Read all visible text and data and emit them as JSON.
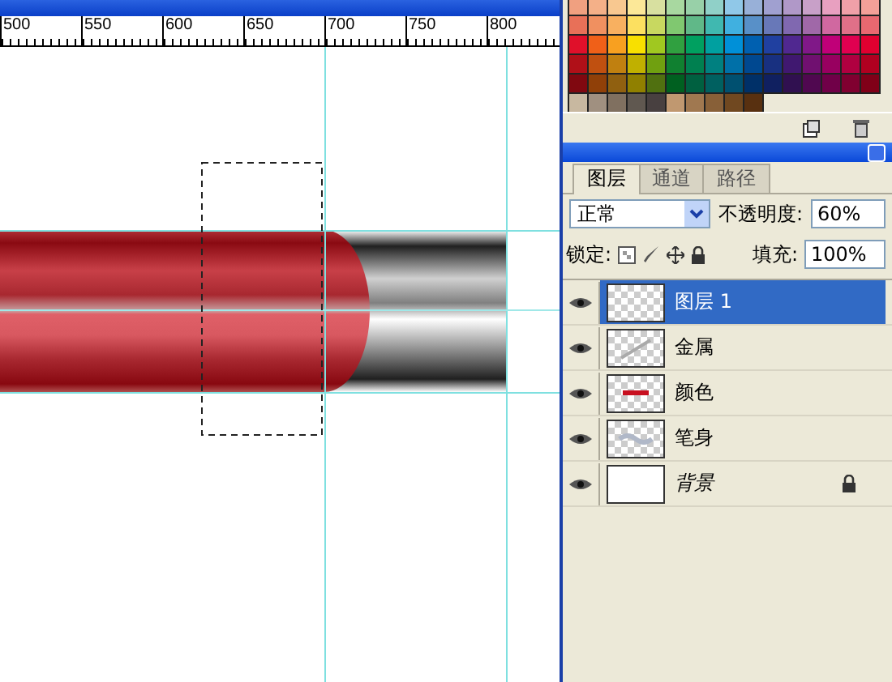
{
  "ruler": {
    "labels": [
      "500",
      "550",
      "600",
      "650",
      "700",
      "750",
      "800"
    ]
  },
  "swatches": [
    [
      {
        "color": "#f0a080"
      },
      {
        "color": "#f4b088"
      },
      {
        "color": "#f8c890"
      },
      {
        "color": "#fce898"
      },
      {
        "color": "#d8e0a0"
      },
      {
        "color": "#a8d8a0"
      },
      {
        "color": "#98d0a8"
      },
      {
        "color": "#90d0c8"
      },
      {
        "color": "#90c8e8"
      },
      {
        "color": "#98b0d8"
      },
      {
        "color": "#a0a0d0"
      },
      {
        "color": "#b098c8"
      },
      {
        "color": "#c8a0c8"
      },
      {
        "color": "#e8a0c0"
      },
      {
        "color": "#f0a0a8"
      },
      {
        "color": "#f4a098"
      }
    ],
    [
      {
        "color": "#e87058"
      },
      {
        "color": "#f09060"
      },
      {
        "color": "#f8b060"
      },
      {
        "color": "#fce060"
      },
      {
        "color": "#c8d860"
      },
      {
        "color": "#80c870"
      },
      {
        "color": "#60b888"
      },
      {
        "color": "#40b8b0"
      },
      {
        "color": "#40b0e0"
      },
      {
        "color": "#5890c8"
      },
      {
        "color": "#6878b8"
      },
      {
        "color": "#8068b0"
      },
      {
        "color": "#a068a8"
      },
      {
        "color": "#d068a0"
      },
      {
        "color": "#e07088"
      },
      {
        "color": "#e86870"
      }
    ],
    [
      {
        "color": "#e0102a"
      },
      {
        "color": "#f06018"
      },
      {
        "color": "#f8a020"
      },
      {
        "color": "#f8e000"
      },
      {
        "color": "#a0c820"
      },
      {
        "color": "#30a040"
      },
      {
        "color": "#00a060"
      },
      {
        "color": "#00a0a0"
      },
      {
        "color": "#0090d8"
      },
      {
        "color": "#0060b0"
      },
      {
        "color": "#2040a0"
      },
      {
        "color": "#502890"
      },
      {
        "color": "#801888"
      },
      {
        "color": "#c00078"
      },
      {
        "color": "#e00050"
      },
      {
        "color": "#e00030"
      }
    ],
    [
      {
        "color": "#b01018"
      },
      {
        "color": "#c05010"
      },
      {
        "color": "#c08010"
      },
      {
        "color": "#c0b000"
      },
      {
        "color": "#70a010"
      },
      {
        "color": "#108030"
      },
      {
        "color": "#008050"
      },
      {
        "color": "#008080"
      },
      {
        "color": "#0070a8"
      },
      {
        "color": "#004890"
      },
      {
        "color": "#183080"
      },
      {
        "color": "#401870"
      },
      {
        "color": "#701070"
      },
      {
        "color": "#980060"
      },
      {
        "color": "#b00040"
      },
      {
        "color": "#b00020"
      }
    ],
    [
      {
        "color": "#800810"
      },
      {
        "color": "#904008"
      },
      {
        "color": "#906010"
      },
      {
        "color": "#908000"
      },
      {
        "color": "#507010"
      },
      {
        "color": "#006020"
      },
      {
        "color": "#006040"
      },
      {
        "color": "#006060"
      },
      {
        "color": "#005070"
      },
      {
        "color": "#003068"
      },
      {
        "color": "#102060"
      },
      {
        "color": "#301050"
      },
      {
        "color": "#500850"
      },
      {
        "color": "#700048"
      },
      {
        "color": "#800030"
      },
      {
        "color": "#800018"
      }
    ],
    [
      {
        "color": "#c8b8a0"
      },
      {
        "color": "#a09080"
      },
      {
        "color": "#807060"
      },
      {
        "color": "#605850"
      },
      {
        "color": "#484040"
      },
      {
        "color": "#c09870"
      },
      {
        "color": "#a07850"
      },
      {
        "color": "#886038"
      },
      {
        "color": "#704820"
      },
      {
        "color": "#583010"
      }
    ]
  ],
  "layers_panel": {
    "tabs": [
      {
        "label": "图层",
        "selected": true
      },
      {
        "label": "通道",
        "selected": false
      },
      {
        "label": "路径",
        "selected": false
      }
    ],
    "blend_mode": "正常",
    "opacity_label": "不透明度:",
    "opacity": "60%",
    "lock_label": "锁定:",
    "fill_label": "填充:",
    "fill": "100%",
    "layers": [
      {
        "name": "图层 1",
        "selected": true,
        "visible": true,
        "locked": false,
        "kind": "checker"
      },
      {
        "name": "金属",
        "selected": false,
        "visible": true,
        "locked": false,
        "kind": "checker-line"
      },
      {
        "name": "颜色",
        "selected": false,
        "visible": true,
        "locked": false,
        "kind": "checker-red"
      },
      {
        "name": "笔身",
        "selected": false,
        "visible": true,
        "locked": false,
        "kind": "checker-smudge"
      },
      {
        "name": "背景",
        "selected": false,
        "visible": true,
        "locked": true,
        "kind": "white"
      }
    ]
  }
}
